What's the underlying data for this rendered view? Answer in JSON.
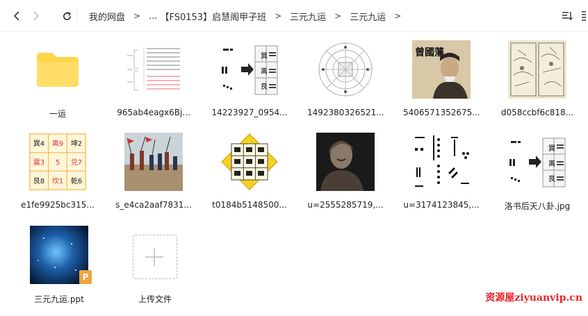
{
  "toolbar": {
    "back_icon": "chevron-left-icon",
    "forward_icon": "chevron-right-icon",
    "refresh_icon": "refresh-icon",
    "breadcrumbs": [
      "我的网盘",
      "...",
      "【FS0153】启慧阁甲子班",
      "三元九运",
      "三元九运"
    ],
    "separator": ">",
    "sort_icon": "sort-icon",
    "view_icon": "grid-view-icon"
  },
  "files": [
    {
      "name": "一运",
      "kind": "folder"
    },
    {
      "name": "965ab4eagx6Bj...",
      "kind": "image"
    },
    {
      "name": "14223927_0954...",
      "kind": "image"
    },
    {
      "name": "1492380326521...",
      "kind": "image"
    },
    {
      "name": "5406571352675...",
      "kind": "image"
    },
    {
      "name": "d058ccbf6c818...",
      "kind": "image"
    },
    {
      "name": "e1fe9925bc315...",
      "kind": "image"
    },
    {
      "name": "s_e4ca2aaf7831...",
      "kind": "image"
    },
    {
      "name": "t0184b5148500...",
      "kind": "image"
    },
    {
      "name": "u=2555285719,...",
      "kind": "image"
    },
    {
      "name": "u=3174123845,...",
      "kind": "image"
    },
    {
      "name": "洛书后天八卦.jpg",
      "kind": "image"
    },
    {
      "name": "三元九运.ppt",
      "kind": "ppt"
    },
    {
      "name": "上传文件",
      "kind": "upload"
    }
  ],
  "thumb_text": {
    "grid": [
      "巽4",
      "离9",
      "坤2",
      "震3",
      "5",
      "兑7",
      "艮8",
      "坎1",
      "乾6"
    ],
    "portrait_title": "曾國藩",
    "luoshu_labels": [
      "巽",
      "离",
      "艮"
    ],
    "ppt_badge": "P"
  },
  "colors": {
    "folder": "#ffd54a",
    "ppt_badge": "#f0a33c",
    "watermark": "#e8242a",
    "accent": "#333333"
  },
  "watermark": "资源屋ziyuanvip.cn"
}
